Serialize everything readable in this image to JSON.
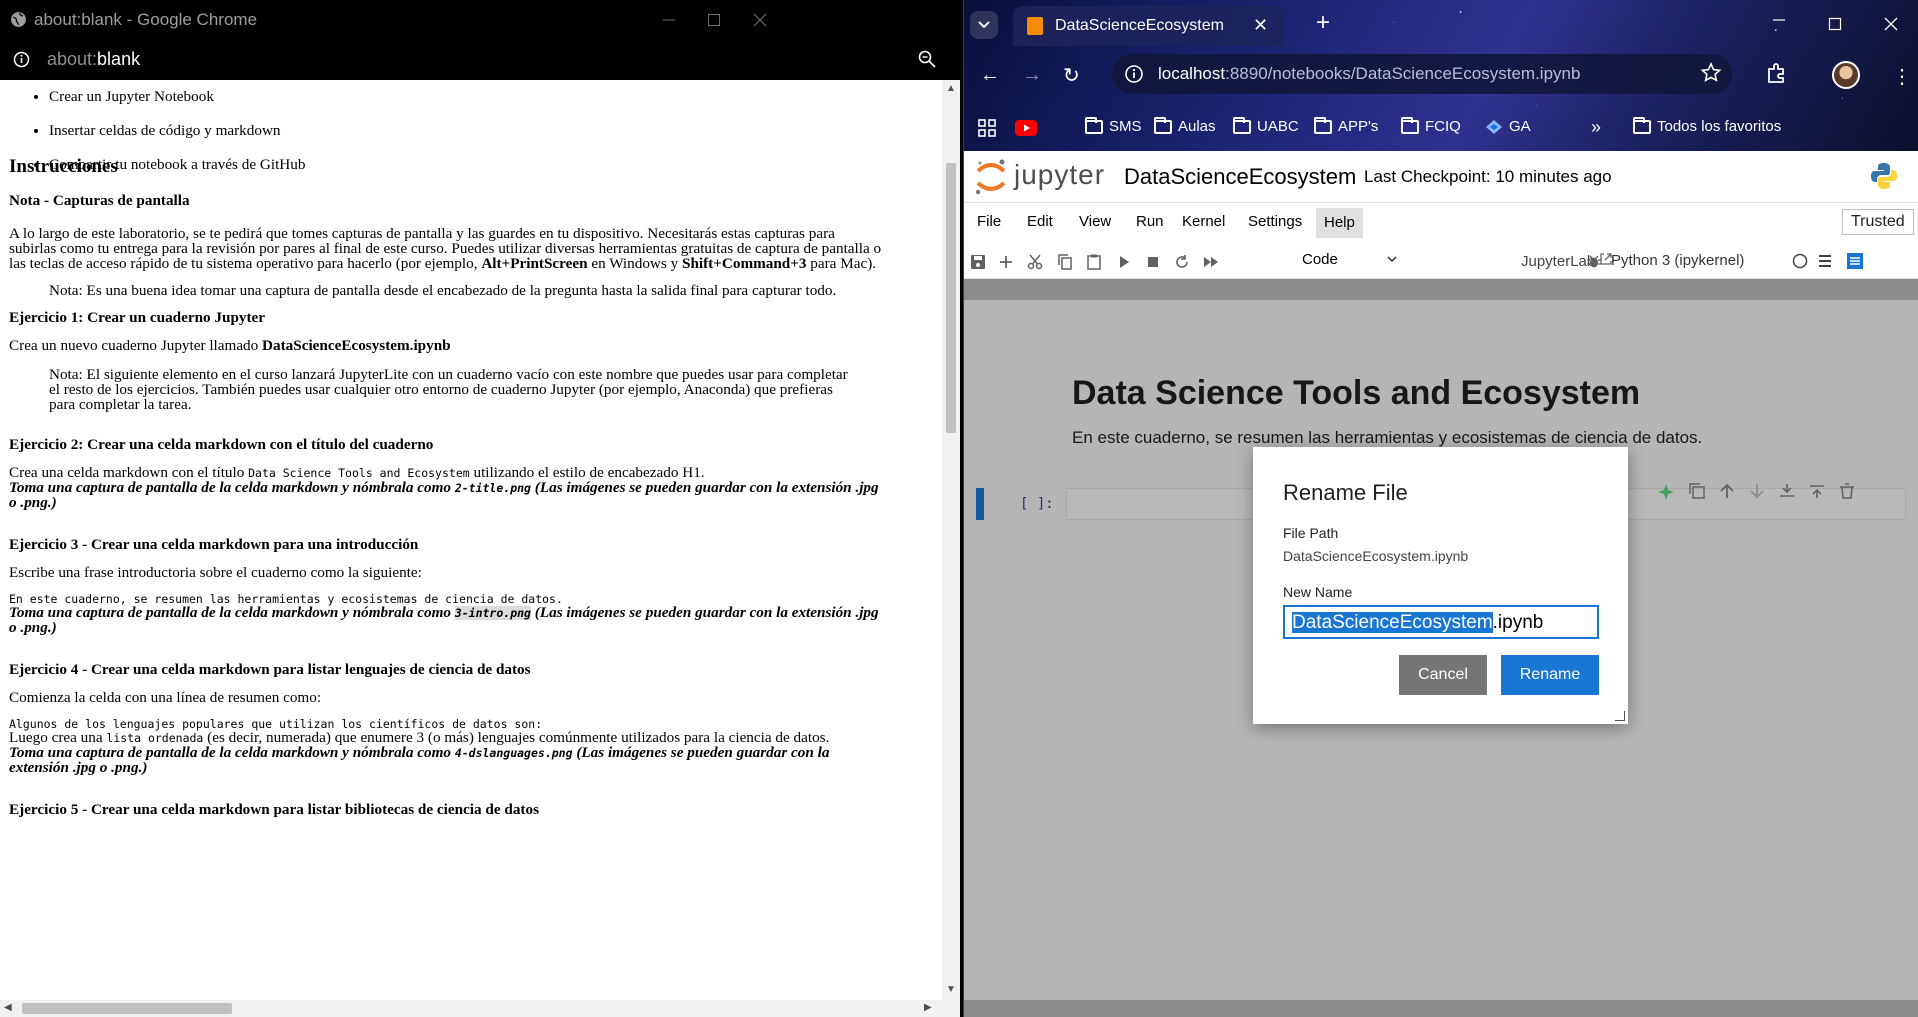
{
  "left_window": {
    "title": "about:blank - Google Chrome",
    "url_prefix": "about:",
    "url_rest": "blank"
  },
  "doc": {
    "bullets": [
      "Crear un Jupyter Notebook",
      "Insertar celdas de código y markdown",
      "Compartir tu notebook a través de GitHub"
    ],
    "instrucciones": "Instrucciones",
    "nota_title": "Nota - Capturas de pantalla",
    "nota_p1": "A lo largo de este laboratorio, se te pedirá que tomes capturas de pantalla y las guardes en tu dispositivo. Necesitarás estas capturas para",
    "nota_p2": "subirlas como tu entrega para la revisión por pares al final de este curso. Puedes utilizar diversas herramientas gratuitas de captura de pantalla o",
    "nota_p3a": "las teclas de acceso rápido de tu sistema operativo para hacerlo (por ejemplo, ",
    "nota_p3b": "Alt+PrintScreen",
    "nota_p3c": " en Windows y ",
    "nota_p3d": "Shift+Command+3",
    "nota_p3e": " para Mac).",
    "nota_quote": "Nota: Es una buena idea tomar una captura de pantalla desde el encabezado de la pregunta hasta la salida final para capturar todo.",
    "ej1_title": "Ejercicio 1: Crear un cuaderno Jupyter",
    "ej1_p_a": "Crea un nuevo cuaderno Jupyter llamado ",
    "ej1_p_b": "DataScienceEcosystem.ipynb",
    "ej1_q1": "Nota: El siguiente elemento en el curso lanzará JupyterLite con un cuaderno vacío con este nombre que puedes usar para completar",
    "ej1_q2": "el resto de los ejercicios. También puedes usar cualquier otro entorno de cuaderno Jupyter (por ejemplo, Anaconda) que prefieras",
    "ej1_q3": "para completar la tarea.",
    "ej2_title": "Ejercicio 2: Crear una celda markdown con el título del cuaderno",
    "ej2_p_a": "Crea una celda markdown con el título ",
    "ej2_p_code": "Data Science Tools and Ecosystem",
    "ej2_p_b": " utilizando el estilo de encabezado H1.",
    "ej2_em_a": "Toma una captura de pantalla de la celda markdown y nómbrala como ",
    "ej2_em_code": "2-title.png",
    "ej2_em_b": " (Las imágenes se pueden guardar con la extensión .jpg",
    "ej2_em_c": "o .png.)",
    "ej3_title": "Ejercicio 3 - Crear una celda markdown para una introducción",
    "ej3_p": "Escribe una frase introductoria sobre el cuaderno como la siguiente:",
    "ej3_code": "En este cuaderno, se resumen las herramientas y ecosistemas de ciencia de datos.",
    "ej3_em_a": "Toma una captura de pantalla de la celda markdown y nómbrala como ",
    "ej3_em_code": "3-intro.png",
    "ej3_em_b": " (Las imágenes se pueden guardar con la extensión .jpg",
    "ej3_em_c": "o .png.)",
    "ej4_title": "Ejercicio 4 - Crear una celda markdown para listar lenguajes de ciencia de datos",
    "ej4_p": "Comienza la celda con una línea de resumen como:",
    "ej4_code": "Algunos de los lenguajes populares que utilizan los científicos de datos son:",
    "ej4_p2_a": "Luego crea una ",
    "ej4_p2_code": "lista ordenada",
    "ej4_p2_b": " (es decir, numerada) que enumere 3 (o más) lenguajes comúnmente utilizados para la ciencia de datos.",
    "ej4_em_a": "Toma una captura de pantalla de la celda markdown y nómbrala como ",
    "ej4_em_code": "4-dslanguages.png",
    "ej4_em_b": " (Las imágenes se pueden guardar con la extensión .jpg o .png.)",
    "ej4_em_c": "extensión .jpg o .png.)",
    "ej5_title": "Ejercicio 5 - Crear una celda markdown para listar bibliotecas de ciencia de datos"
  },
  "right_window": {
    "tab_title": "DataScienceEcosystem",
    "url_host": "localhost",
    "url_rest": ":8890/notebooks/DataScienceEcosystem.ipynb",
    "bookmarks": [
      {
        "label": "SMS",
        "icon": "folder-icon"
      },
      {
        "label": "Aulas",
        "icon": "folder-icon"
      },
      {
        "label": "UABC",
        "icon": "folder-icon"
      },
      {
        "label": "APP's",
        "icon": "folder-icon"
      },
      {
        "label": "FCIQ",
        "icon": "folder-icon"
      },
      {
        "label": "GA",
        "icon": "analytics-icon"
      }
    ],
    "all_bookmarks": "Todos los favoritos"
  },
  "jupyter": {
    "logo_word": "jupyter",
    "notebook_name": "DataScienceEcosystem",
    "checkpoint": "Last Checkpoint: 10 minutes ago",
    "menu": [
      "File",
      "Edit",
      "View",
      "Run",
      "Kernel",
      "Settings",
      "Help"
    ],
    "trusted": "Trusted",
    "cell_type": "Code",
    "jupyterlab": "JupyterLab",
    "kernel": "Python 3 (ipykernel)",
    "heading": "Data Science Tools and Ecosystem",
    "intro": "En este cuaderno, se resumen las herramientas y ecosistemas de ciencia de datos.",
    "prompt": "[ ]:"
  },
  "dialog": {
    "title": "Rename File",
    "file_path_label": "File Path",
    "file_path_value": "DataScienceEcosystem.ipynb",
    "new_name_label": "New Name",
    "new_name_value": "DataScienceEcosystem.ipynb",
    "new_name_selected": "DataScienceEcosystem",
    "new_name_ext": ".ipynb",
    "cancel": "Cancel",
    "rename": "Rename"
  },
  "colors": {
    "jupyter_blue": "#1976d2",
    "jupyter_orange": "#f37626",
    "cancel_gray": "#757575"
  }
}
